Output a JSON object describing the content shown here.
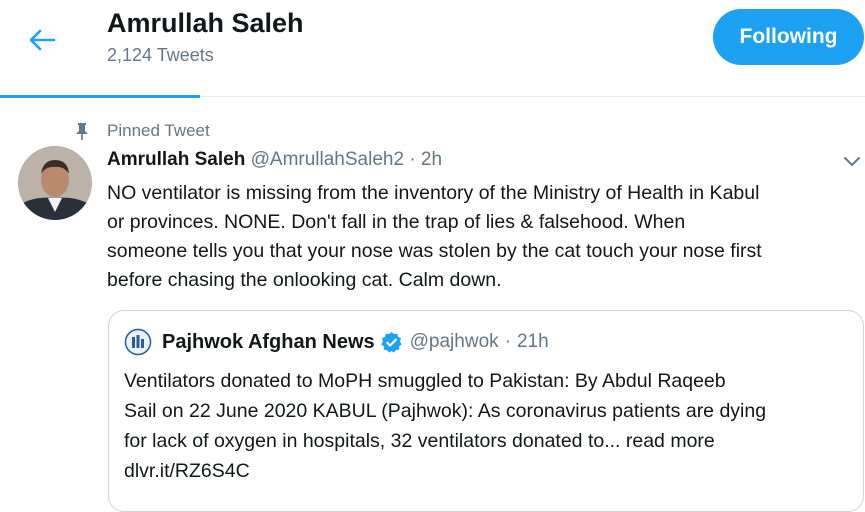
{
  "header": {
    "profile_name": "Amrullah Saleh",
    "tweet_count": "2,124 Tweets",
    "follow_label": "Following",
    "back_icon": "arrow-left-icon"
  },
  "tweet": {
    "pinned_label": "Pinned Tweet",
    "author_name": "Amrullah Saleh",
    "handle": "@AmrullahSaleh2",
    "separator": "·",
    "time": "2h",
    "lines": [
      "NO ventilator is missing from the inventory of the Ministry of Health in Kabul",
      "or provinces. NONE. Don't fall in the trap of lies & falsehood. When",
      "someone tells you that your nose was stolen by the cat touch your nose first",
      "before chasing the onlooking cat. Calm down."
    ]
  },
  "quote": {
    "name": "Pajhwok Afghan News",
    "handle": "@pajhwok",
    "separator": "·",
    "time": "21h",
    "lines": [
      "Ventilators donated to MoPH smuggled to Pakistan: By Abdul Raqeeb",
      "Sail on 22 June 2020 KABUL (Pajhwok): As coronavirus patients are dying",
      "for lack of oxygen in hospitals, 32 ventilators donated to... read more",
      "dlvr.it/RZ6S4C"
    ]
  },
  "colors": {
    "accent": "#1da1f2",
    "secondary_text": "#657786",
    "primary_text": "#14171a",
    "border": "#ccd6dd"
  }
}
